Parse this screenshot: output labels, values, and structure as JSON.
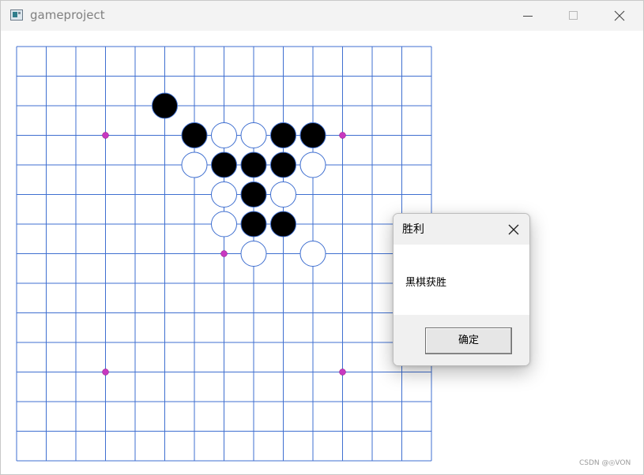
{
  "window": {
    "title": "gameproject",
    "app_icon": "app-window-icon",
    "controls": {
      "minimize_icon": "minimize-icon",
      "maximize_icon": "maximize-icon",
      "close_icon": "close-icon"
    }
  },
  "board": {
    "rows": 15,
    "cols": 15,
    "grid_color": "#3f6fd0",
    "star_color": "#c838c0",
    "star_points": [
      [
        3,
        3
      ],
      [
        11,
        3
      ],
      [
        7,
        7
      ],
      [
        3,
        11
      ],
      [
        11,
        11
      ]
    ],
    "black_stones": [
      [
        5,
        2
      ],
      [
        6,
        3
      ],
      [
        9,
        3
      ],
      [
        10,
        3
      ],
      [
        7,
        4
      ],
      [
        8,
        4
      ],
      [
        9,
        4
      ],
      [
        8,
        5
      ],
      [
        8,
        6
      ],
      [
        9,
        6
      ]
    ],
    "white_stones": [
      [
        7,
        3
      ],
      [
        8,
        3
      ],
      [
        6,
        4
      ],
      [
        10,
        4
      ],
      [
        7,
        5
      ],
      [
        9,
        5
      ],
      [
        7,
        6
      ],
      [
        8,
        7
      ],
      [
        10,
        7
      ]
    ]
  },
  "dialog": {
    "title": "胜利",
    "message": "黑棋获胜",
    "ok_label": "确定",
    "close_icon": "close-icon"
  },
  "watermark": "CSDN @◎VON",
  "colors": {
    "titlebar_bg": "#f3f3f3",
    "dialog_footer_bg": "#f0f0f0",
    "black_stone": "#000000",
    "white_stone": "#ffffff"
  }
}
